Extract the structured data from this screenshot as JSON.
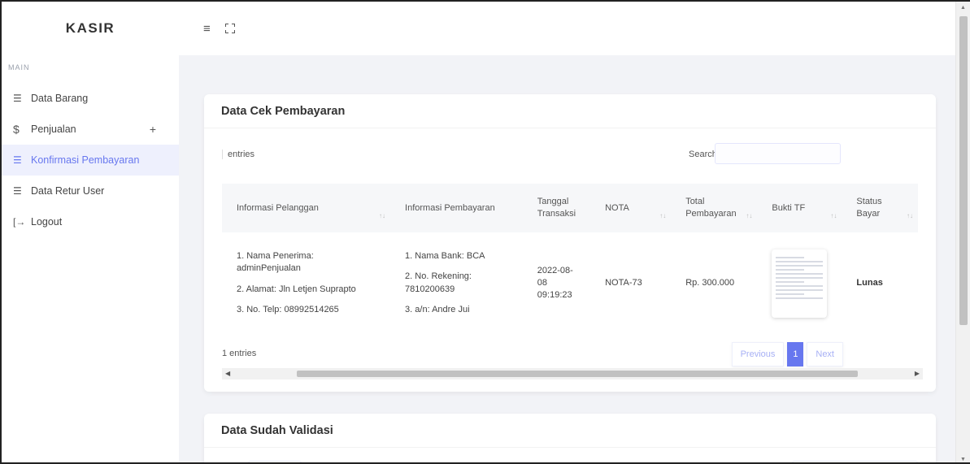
{
  "sidebar": {
    "brand": "KASIR",
    "menu_header": "MAIN",
    "items": [
      {
        "label": "Data Barang",
        "icon": "list-icon"
      },
      {
        "label": "Penjualan",
        "icon": "dollar-icon",
        "expand": "+"
      },
      {
        "label": "Konfirmasi Pembayaran",
        "icon": "list-icon",
        "active": true
      },
      {
        "label": "Data Retur User",
        "icon": "list-icon"
      },
      {
        "label": "Logout",
        "icon": "logout-icon"
      }
    ]
  },
  "topbar": {
    "menu_icon": "hamburger-icon",
    "fullscreen_icon": "fullscreen-icon"
  },
  "card1": {
    "title": "Data Cek Pembayaran",
    "entries_label": "entries",
    "search_label": "Search:",
    "columns": [
      {
        "label": "Informasi Pelanggan"
      },
      {
        "label": "Informasi Pembayaran"
      },
      {
        "label": "Tanggal Transaksi"
      },
      {
        "label": "NOTA"
      },
      {
        "label": "Total Pembayaran"
      },
      {
        "label": "Bukti TF"
      },
      {
        "label": "Status Bayar"
      }
    ],
    "row": {
      "pelanggan": [
        "1. Nama Penerima: adminPenjualan",
        "2. Alamat: Jln Letjen Suprapto",
        "3. No. Telp: 08992514265"
      ],
      "pembayaran": [
        "1. Nama Bank: BCA",
        "2. No. Rekening: 7810200639",
        "3. a/n: Andre Jui"
      ],
      "tanggal": "2022-08-08 09:19:23",
      "nota": "NOTA-73",
      "total": "Rp. 300.000",
      "status": "Lunas"
    },
    "info": "1 entries",
    "pagination": {
      "previous": "Previous",
      "current": "1",
      "next": "Next"
    }
  },
  "card2": {
    "title": "Data Sudah Validasi"
  },
  "colors": {
    "accent": "#6777ef",
    "active_bg": "#eef0fd",
    "page_bg": "#f2f3f7"
  }
}
